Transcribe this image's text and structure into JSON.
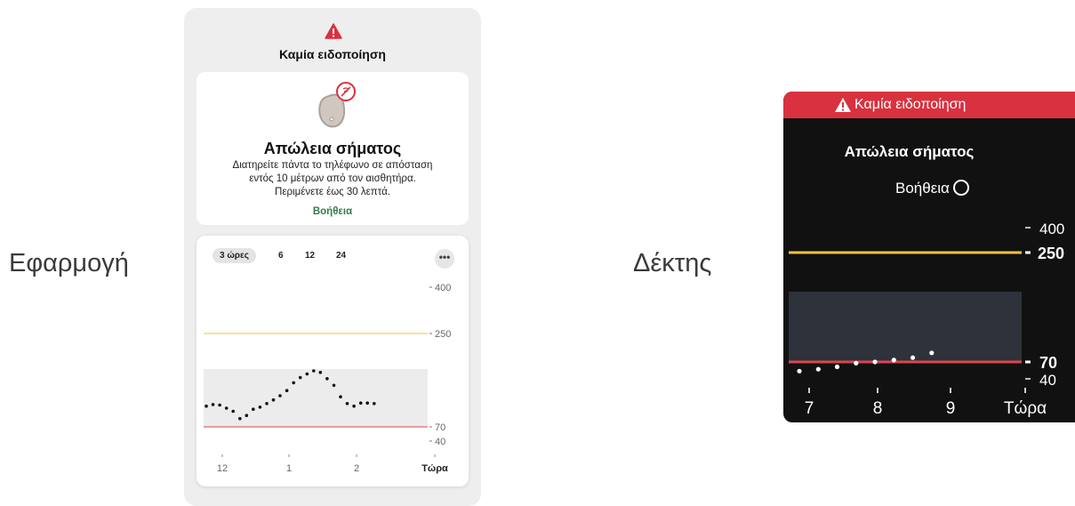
{
  "labels": {
    "app": "Εφαρμογή",
    "receiver": "Δέκτης"
  },
  "app": {
    "alert_title": "Καμία ειδοποίηση",
    "card": {
      "title": "Απώλεια σήματος",
      "body_lines": [
        "Διατηρείτε πάντα το τηλέφωνο σε απόσταση",
        "εντός 10 μέτρων από τον αισθητήρα.",
        "Περιμένετε έως 30 λεπτά."
      ],
      "help": "Βοήθεια"
    },
    "ranges": [
      "3 ώρες",
      "6",
      "12",
      "24"
    ],
    "more": "•••",
    "chart": {
      "y_ticks": [
        "400",
        "250",
        "70",
        "40"
      ],
      "x_ticks": [
        "12",
        "1",
        "2",
        "Τώρα"
      ]
    }
  },
  "receiver": {
    "banner": "Καμία ειδοποίηση",
    "title": "Απώλεια σήματος",
    "help": "Βοήθεια",
    "y_ticks": [
      "400",
      "250",
      "70",
      "40"
    ],
    "x_ticks": [
      "7",
      "8",
      "9",
      "Τώρα"
    ]
  },
  "colors": {
    "alert_red": "#d9313f",
    "help_green": "#2e7d46",
    "high_line": "#f2c23e",
    "low_line": "#e0424b"
  },
  "chart_data": [
    {
      "type": "scatter",
      "title": "",
      "x": [
        12.0,
        12.1,
        12.2,
        12.3,
        12.4,
        12.5,
        12.6,
        12.7,
        12.8,
        12.9,
        13.0,
        13.1,
        13.2,
        13.3,
        13.4,
        13.5,
        13.6,
        13.7,
        13.8,
        13.9,
        14.0,
        14.1,
        14.2,
        14.3,
        14.4,
        14.5
      ],
      "y": [
        110,
        113,
        112,
        106,
        100,
        86,
        92,
        104,
        108,
        115,
        122,
        130,
        140,
        155,
        165,
        172,
        178,
        175,
        163,
        150,
        128,
        115,
        110,
        116,
        116,
        115
      ],
      "ylim": [
        40,
        400
      ],
      "reference_lines": [
        250,
        70
      ],
      "x_tick_labels": [
        "12",
        "1",
        "2",
        "Τώρα"
      ]
    },
    {
      "type": "scatter",
      "title": "",
      "x": [
        7.0,
        7.25,
        7.5,
        7.75,
        8.0,
        8.25,
        8.5,
        8.75
      ],
      "y": [
        55,
        58,
        62,
        68,
        70,
        73,
        77,
        85
      ],
      "ylim": [
        40,
        400
      ],
      "reference_lines": [
        250,
        70
      ],
      "x_tick_labels": [
        "7",
        "8",
        "9",
        "Τώρα"
      ]
    }
  ]
}
